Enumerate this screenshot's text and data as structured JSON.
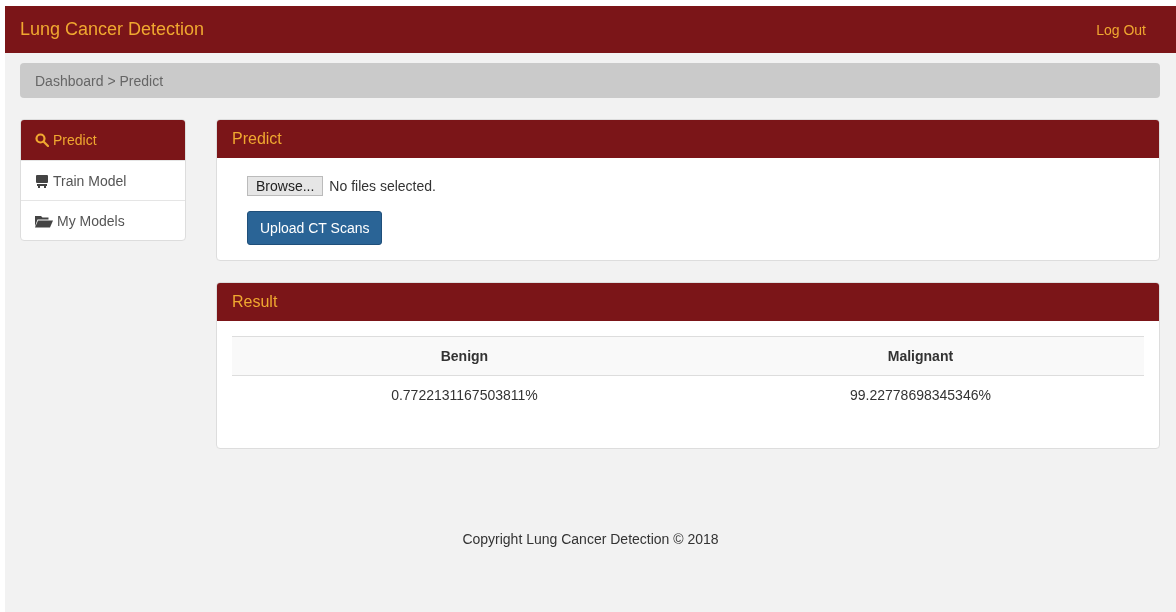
{
  "navbar": {
    "brand": "Lung Cancer Detection",
    "logout": "Log Out"
  },
  "breadcrumb": "Dashboard > Predict",
  "sidebar": {
    "items": [
      {
        "label": "Predict",
        "kind": "search",
        "selected": true
      },
      {
        "label": "Train Model",
        "kind": "monitor",
        "selected": false
      },
      {
        "label": "My Models",
        "kind": "folder",
        "selected": false
      }
    ]
  },
  "predict_panel": {
    "title": "Predict",
    "browse_button": "Browse...",
    "file_status": "No files selected.",
    "upload_button": "Upload CT Scans"
  },
  "result_panel": {
    "title": "Result",
    "table": {
      "columns": [
        "Benign",
        "Malignant"
      ],
      "rows": [
        [
          "0.7722131167503811%",
          "99.22778698345346%"
        ]
      ]
    }
  },
  "footer": "Copyright Lung Cancer Detection © 2018"
}
